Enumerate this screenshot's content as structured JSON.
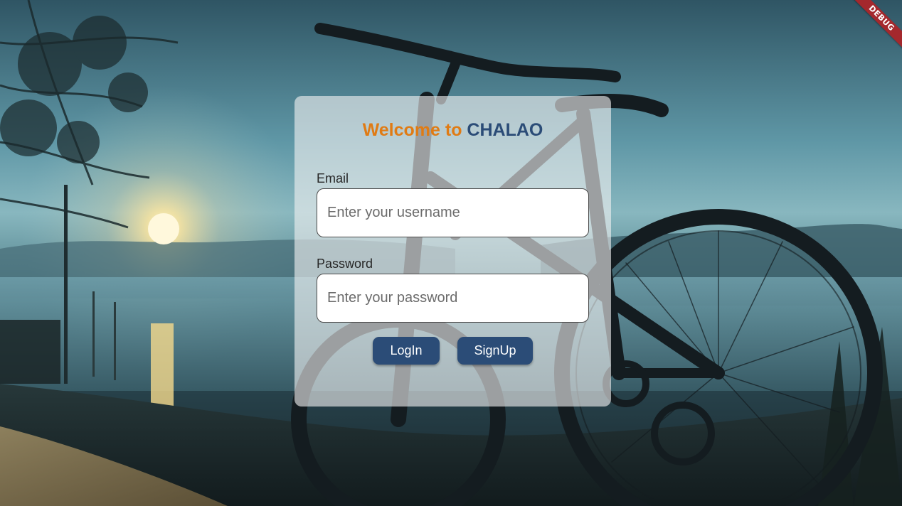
{
  "debug_banner": "DEBUG",
  "title": {
    "prefix": "Welcome to ",
    "brand": "CHALAO"
  },
  "email": {
    "label": "Email",
    "placeholder": "Enter your username",
    "value": ""
  },
  "password": {
    "label": "Password",
    "placeholder": "Enter your password",
    "value": ""
  },
  "buttons": {
    "login": "LogIn",
    "signup": "SignUp"
  },
  "colors": {
    "accent_orange": "#e07b14",
    "brand_blue": "#2b4c77",
    "debug_red": "#a4282d"
  },
  "background": "bicycle-lakeside-dusk-photo"
}
